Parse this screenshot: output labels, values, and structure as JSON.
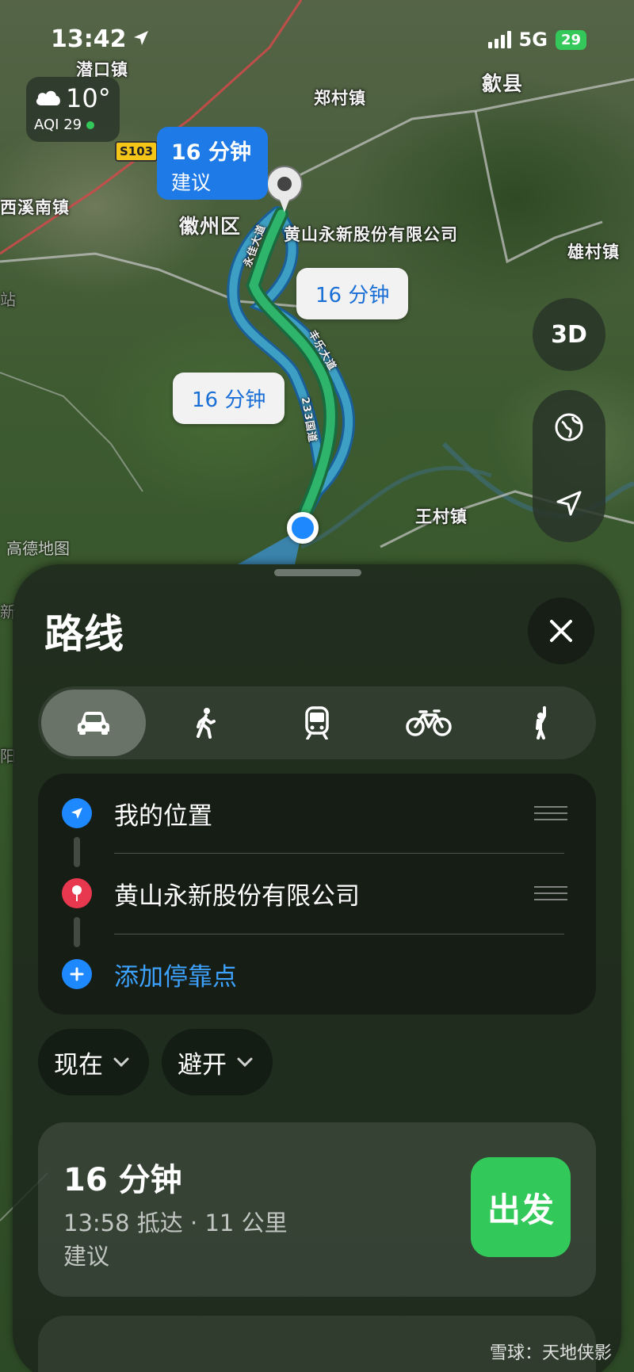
{
  "status_bar": {
    "time": "13:42",
    "network": "5G",
    "battery": "29",
    "location_arrow_icon": "location-arrow-icon"
  },
  "weather": {
    "temperature": "10°",
    "aqi": "AQI 29",
    "icon": "cloud-icon"
  },
  "map": {
    "places": {
      "p1": "潜口镇",
      "p2": "郑村镇",
      "p3": "歙县",
      "p4": "西溪南镇",
      "p5": "徽州区",
      "p6": "雄村镇",
      "p7": "王村镇",
      "p8": "站",
      "p9": "新",
      "p10": "阳"
    },
    "road_sign": "S103",
    "destination_label": "黄山永新股份有限公司",
    "road_labels": {
      "r1": "永佳大道",
      "r2": "丰乐大道",
      "r3": "233国道"
    },
    "callout_primary": {
      "time": "16 分钟",
      "tag": "建议"
    },
    "callout_alt_1": "16 分钟",
    "callout_alt_2": "16 分钟",
    "control_3d": "3D",
    "watermark": "高德地图"
  },
  "sheet": {
    "title": "路线",
    "transport_modes": [
      {
        "name": "驾车",
        "icon": "car-icon",
        "active": true
      },
      {
        "name": "步行",
        "icon": "walk-icon",
        "active": false
      },
      {
        "name": "公交",
        "icon": "train-icon",
        "active": false
      },
      {
        "name": "骑行",
        "icon": "bicycle-icon",
        "active": false
      },
      {
        "name": "打车",
        "icon": "hail-icon",
        "active": false
      }
    ],
    "waypoints": {
      "origin": "我的位置",
      "destination": "黄山永新股份有限公司",
      "add_stop": "添加停靠点"
    },
    "filters": {
      "time": "现在",
      "avoid": "避开"
    },
    "route": {
      "duration": "16 分钟",
      "eta": "13:58 抵达 · 11 公里",
      "tag": "建议",
      "go_label": "出发"
    }
  },
  "footer": {
    "watermark": "雪球：天地侠影"
  },
  "colors": {
    "accent_blue": "#1e7ae6",
    "route_green": "#2fb56b",
    "go_green": "#33c85a",
    "pin_red": "#e8384f"
  }
}
